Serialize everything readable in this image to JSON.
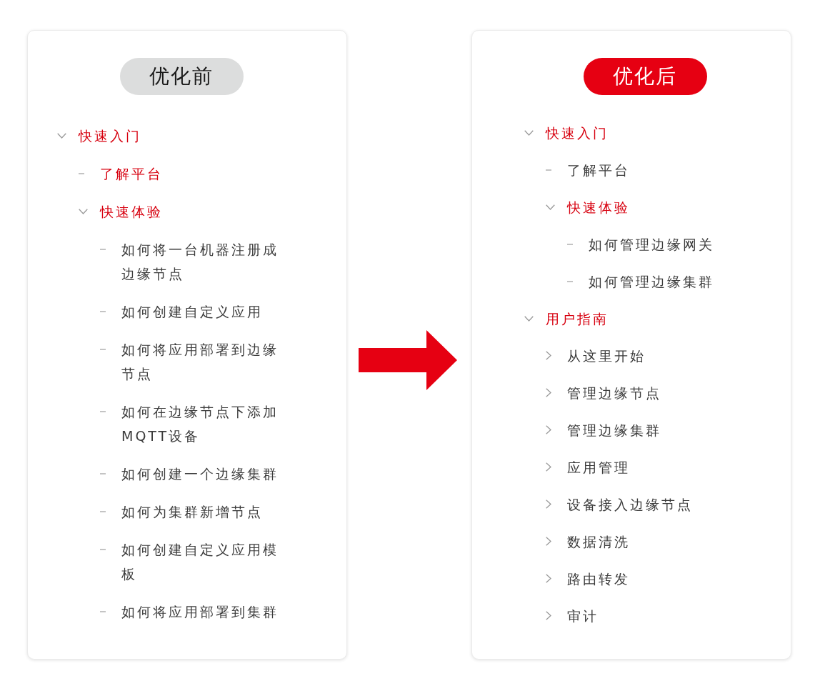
{
  "panels": [
    {
      "badge": {
        "label": "优化前",
        "kind": "neutral"
      },
      "tree": [
        {
          "label": "快速入门",
          "kind": "group",
          "expanded": true,
          "active": true,
          "children": [
            {
              "label": "了解平台",
              "kind": "page",
              "active": true
            },
            {
              "label": "快速体验",
              "kind": "group",
              "expanded": true,
              "active": true,
              "children": [
                {
                  "label": "如何将一台机器注册成边缘节点",
                  "kind": "page",
                  "active": false
                },
                {
                  "label": "如何创建自定义应用",
                  "kind": "page",
                  "active": false
                },
                {
                  "label": "如何将应用部署到边缘节点",
                  "kind": "page",
                  "active": false
                },
                {
                  "label": "如何在边缘节点下添加MQTT设备",
                  "kind": "page",
                  "active": false
                },
                {
                  "label": "如何创建一个边缘集群",
                  "kind": "page",
                  "active": false
                },
                {
                  "label": "如何为集群新增节点",
                  "kind": "page",
                  "active": false
                },
                {
                  "label": "如何创建自定义应用模板",
                  "kind": "page",
                  "active": false
                },
                {
                  "label": "如何将应用部署到集群",
                  "kind": "page",
                  "active": false
                }
              ]
            }
          ]
        }
      ]
    },
    {
      "badge": {
        "label": "优化后",
        "kind": "highlight"
      },
      "tree": [
        {
          "label": "快速入门",
          "kind": "group",
          "expanded": true,
          "active": true,
          "children": [
            {
              "label": "了解平台",
              "kind": "page",
              "active": false
            },
            {
              "label": "快速体验",
              "kind": "group",
              "expanded": true,
              "active": true,
              "children": [
                {
                  "label": "如何管理边缘网关",
                  "kind": "page",
                  "active": false
                },
                {
                  "label": "如何管理边缘集群",
                  "kind": "page",
                  "active": false
                }
              ]
            }
          ]
        },
        {
          "label": "用户指南",
          "kind": "group",
          "expanded": true,
          "active": true,
          "children": [
            {
              "label": "从这里开始",
              "kind": "group",
              "expanded": false,
              "active": false
            },
            {
              "label": "管理边缘节点",
              "kind": "group",
              "expanded": false,
              "active": false
            },
            {
              "label": "管理边缘集群",
              "kind": "group",
              "expanded": false,
              "active": false
            },
            {
              "label": "应用管理",
              "kind": "group",
              "expanded": false,
              "active": false
            },
            {
              "label": "设备接入边缘节点",
              "kind": "group",
              "expanded": false,
              "active": false
            },
            {
              "label": "数据清洗",
              "kind": "group",
              "expanded": false,
              "active": false
            },
            {
              "label": "路由转发",
              "kind": "group",
              "expanded": false,
              "active": false
            },
            {
              "label": "审计",
              "kind": "group",
              "expanded": false,
              "active": false
            }
          ]
        }
      ]
    }
  ]
}
